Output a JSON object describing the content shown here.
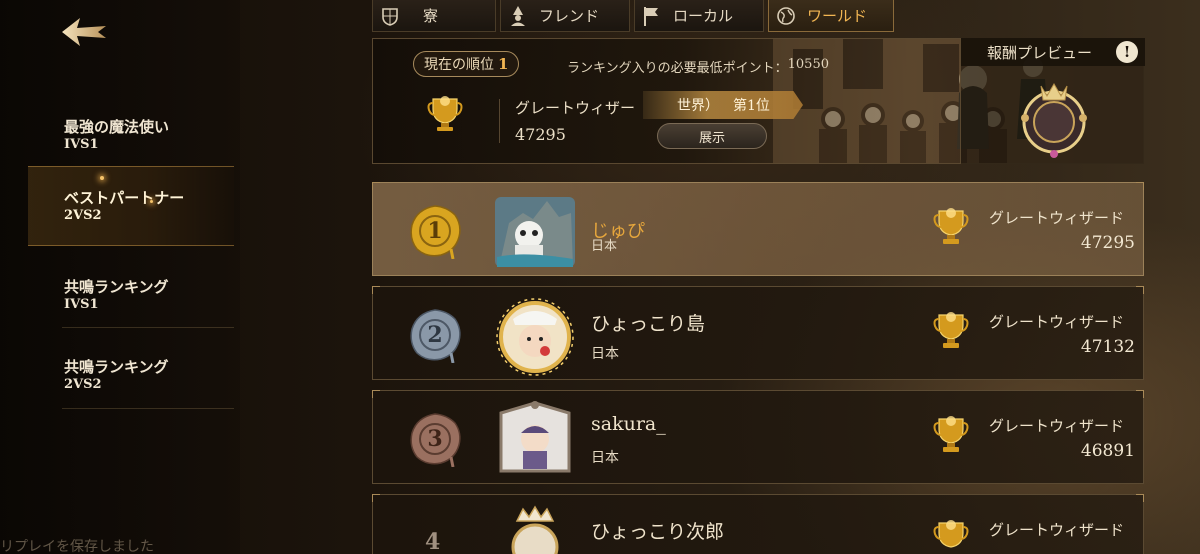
{
  "sidebar": {
    "items": [
      {
        "title": "最強の魔法使い",
        "mode": "IVS1",
        "selected": false
      },
      {
        "title": "ベストパートナー",
        "mode": "2VS2",
        "selected": true
      },
      {
        "title": "共鳴ランキング",
        "mode": "IVS1",
        "selected": false
      },
      {
        "title": "共鳴ランキング",
        "mode": "2VS2",
        "selected": false
      }
    ],
    "toast": "リプレイを保存しました"
  },
  "tabs": [
    {
      "label": "寮",
      "icon": "house-crest-icon",
      "active": false
    },
    {
      "label": "フレンド",
      "icon": "wizard-icon",
      "active": false
    },
    {
      "label": "ローカル",
      "icon": "flag-icon",
      "active": false
    },
    {
      "label": "ワールド",
      "icon": "globe-icon",
      "active": true
    }
  ],
  "banner": {
    "rank_label": "現在の順位",
    "rank_value": "1",
    "min_points_label": "ランキング入りの必要最低ポイント：",
    "min_points_value": "10550",
    "title": "グレートウィザー",
    "score": "47295",
    "badge_region": "世界）",
    "badge_rank": "第1位",
    "show_button": "展示"
  },
  "reward": {
    "label": "報酬プレビュー",
    "info": "!"
  },
  "rows": [
    {
      "rank": "1",
      "name": "じゅぴ",
      "country": "日本",
      "title": "グレートウィザード",
      "score": "47295"
    },
    {
      "rank": "2",
      "name": "ひょっこり島",
      "country": "日本",
      "title": "グレートウィザード",
      "score": "47132"
    },
    {
      "rank": "3",
      "name": "sakura_",
      "country": "日本",
      "title": "グレートウィザード",
      "score": "46891"
    },
    {
      "rank": "4",
      "name": "ひょっこり次郎",
      "country": "",
      "title": "グレートウィザード",
      "score": ""
    }
  ],
  "colors": {
    "accent_gold": "#f2b653",
    "seal_gold": "#d9a520",
    "seal_silver": "#8a98a8",
    "seal_bronze": "#9a7060"
  }
}
